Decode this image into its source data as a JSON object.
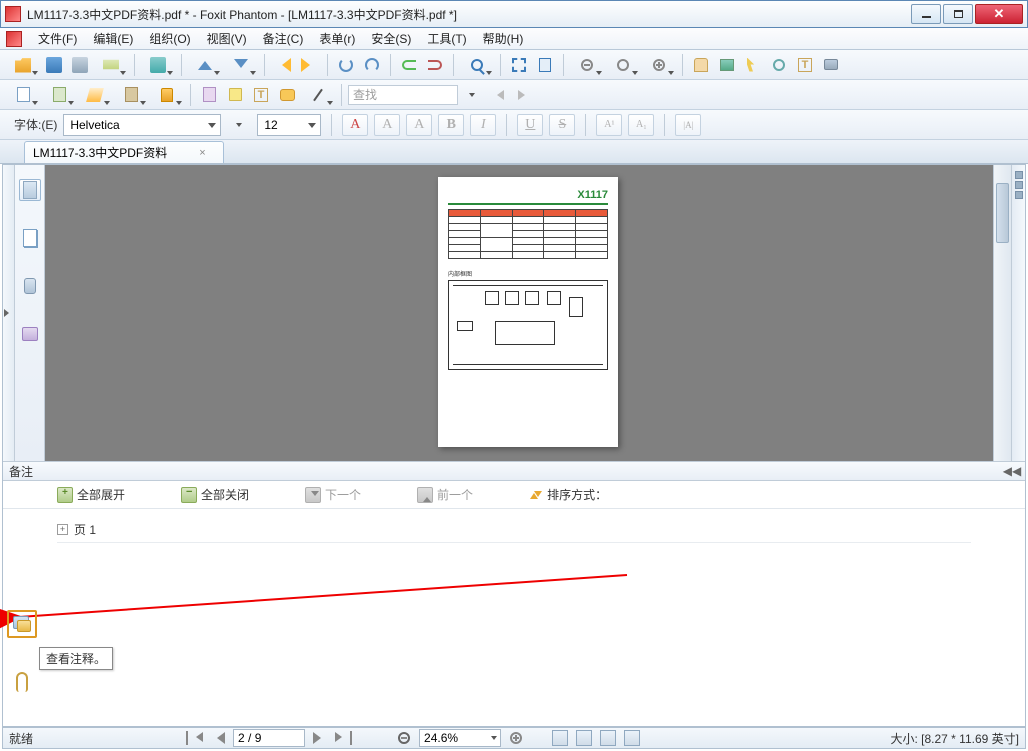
{
  "window": {
    "title": "LM1117-3.3中文PDF资料.pdf * - Foxit Phantom - [LM1117-3.3中文PDF资料.pdf *]"
  },
  "menu": {
    "items": [
      "文件(F)",
      "编辑(E)",
      "组织(O)",
      "视图(V)",
      "备注(C)",
      "表单(r)",
      "安全(S)",
      "工具(T)",
      "帮助(H)"
    ]
  },
  "toolbar2": {
    "search_placeholder": "查找"
  },
  "fontbar": {
    "label": "字体:(E)",
    "font": "Helvetica",
    "size": "12"
  },
  "tab": {
    "title": "LM1117-3.3中文PDF资料",
    "close": "×"
  },
  "page_preview": {
    "header": "X1117",
    "section": "内部框图"
  },
  "comments": {
    "header": "备注",
    "collapse_glyph": "◀◀",
    "expand_all": "全部展开",
    "collapse_all": "全部关闭",
    "next": "下一个",
    "prev": "前一个",
    "sort": "排序方式：",
    "page1_expand": "+",
    "page1_label": "页 1"
  },
  "tooltip": {
    "view_comments": "查看注释。"
  },
  "status": {
    "ready": "就绪",
    "page": "2 / 9",
    "zoom": "24.6%",
    "size": "大小: [8.27 * 11.69 英寸]"
  }
}
